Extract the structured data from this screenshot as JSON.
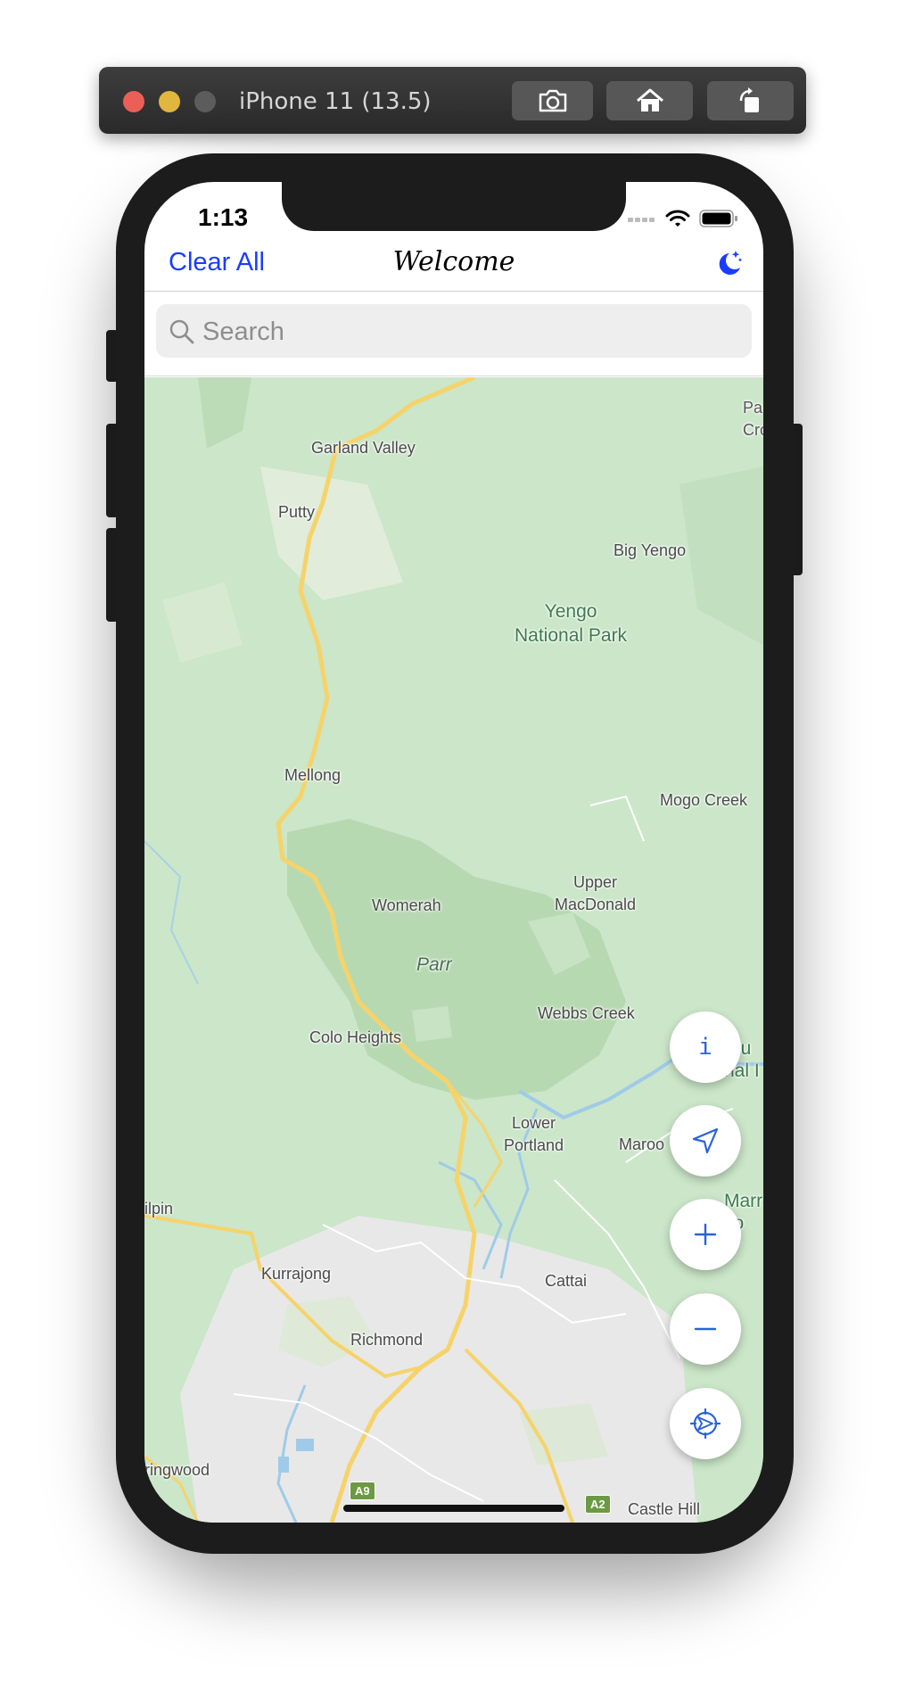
{
  "simulator": {
    "title": "iPhone 11 (13.5)",
    "buttons": [
      "screenshot-icon",
      "home-icon",
      "rotate-icon"
    ]
  },
  "status_bar": {
    "time": "1:13"
  },
  "nav": {
    "left_button": "Clear All",
    "title": "Welcome"
  },
  "search": {
    "placeholder": "Search",
    "value": ""
  },
  "map": {
    "places": {
      "garland_valley": "Garland Valley",
      "putty": "Putty",
      "big_yengo": "Big Yengo",
      "yengo_park": "Yengo\nNational Park",
      "mellong": "Mellong",
      "mogo_creek": "Mogo Creek",
      "upper_macdonald": "Upper\nMacDonald",
      "womerah": "Womerah",
      "parr": "Parr",
      "webbs_creek": "Webbs Creek",
      "colo_heights": "Colo Heights",
      "lower_portland": "Lower\nPortland",
      "maroo": "Maroo",
      "ilpin": "ilpin",
      "kurrajong": "Kurrajong",
      "cattai": "Cattai",
      "richmond": "Richmond",
      "ringwood": "ringwood",
      "castle_hill": "Castle Hill",
      "edge_top": "Pa\nCro",
      "edge_mid": "aru\nnal I",
      "edge_low": "Marr\ntio"
    },
    "shields": {
      "a9": "A9",
      "a2": "A2"
    }
  },
  "fab": {
    "info_label": "i",
    "icons": [
      "info-icon",
      "location-arrow-icon",
      "zoom-in-icon",
      "zoom-out-icon",
      "compass-settings-icon"
    ]
  },
  "colors": {
    "accent": "#1a3cff",
    "fab_icon": "#2a63d8",
    "map_green": "#cbe6c9",
    "road_yellow": "#f6d36a"
  }
}
